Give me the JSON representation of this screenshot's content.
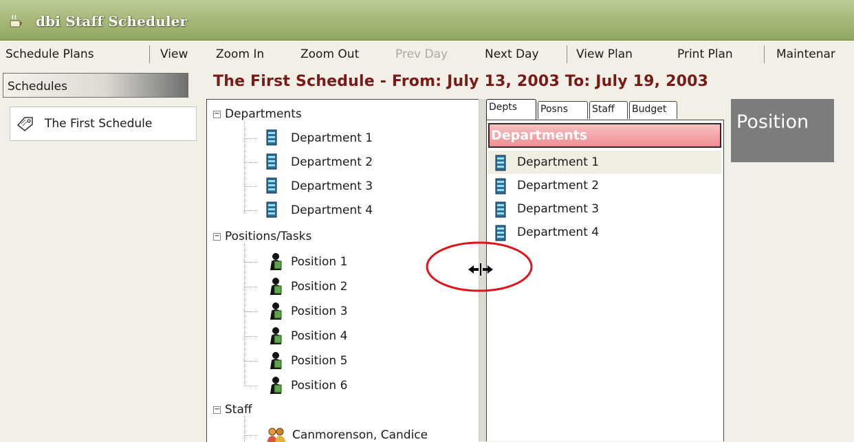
{
  "window": {
    "title": "dbi Staff Scheduler"
  },
  "menu": {
    "schedule_plans": "Schedule Plans",
    "view": "View",
    "zoom_in": "Zoom In",
    "zoom_out": "Zoom Out",
    "prev_day": "Prev Day",
    "next_day": "Next Day",
    "view_plan": "View Plan",
    "print_plan": "Print Plan",
    "maintenance": "Maintenar"
  },
  "sidebar": {
    "header": "Schedules",
    "items": [
      {
        "label": "The First Schedule"
      }
    ]
  },
  "schedule_title": "The First Schedule - From: July 13, 2003 To: July 19, 2003",
  "tree": {
    "departments": {
      "label": "Departments",
      "expander": "−",
      "children": [
        "Department 1",
        "Department 2",
        "Department 3",
        "Department 4"
      ]
    },
    "positions": {
      "label": "Positions/Tasks",
      "expander": "−",
      "children": [
        "Position 1",
        "Position 2",
        "Position 3",
        "Position 4",
        "Position 5",
        "Position 6"
      ]
    },
    "staff": {
      "label": "Staff",
      "expander": "−",
      "children": [
        "Canmorenson, Candice"
      ]
    }
  },
  "panel": {
    "tabs": [
      "Depts",
      "Posns",
      "Staff",
      "Budget"
    ],
    "active_tab": "Depts",
    "list_header": "Departments",
    "items": [
      "Department 1",
      "Department 2",
      "Department 3",
      "Department 4"
    ],
    "selected_item": "Department 1"
  },
  "position_header": "Position",
  "colors": {
    "title_bar": "#a4b777",
    "schedule_title": "#7a1a18",
    "list_header": "#ef8d92",
    "highlight_ellipse": "#e2121a",
    "position_header_bg": "#7c7c7c"
  },
  "icons": {
    "app": "app-icon",
    "schedule": "schedule-tag-icon",
    "department": "department-icon",
    "position": "position-person-icon",
    "staff": "staff-people-icon",
    "cursor": "resize-horizontal-cursor-icon"
  }
}
